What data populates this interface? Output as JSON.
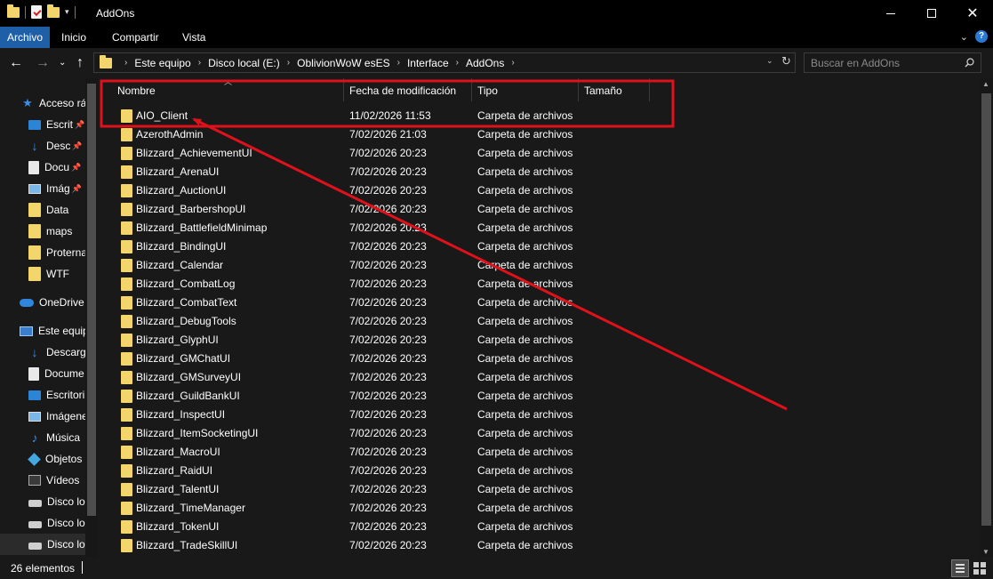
{
  "window": {
    "title": "AddOns"
  },
  "ribbon": {
    "tabs": [
      "Archivo",
      "Inicio",
      "Compartir",
      "Vista"
    ]
  },
  "address": {
    "segments": [
      "Este equipo",
      "Disco local (E:)",
      "OblivionWoW esES",
      "Interface",
      "AddOns"
    ]
  },
  "search": {
    "placeholder": "Buscar en AddOns"
  },
  "nav": {
    "items": [
      {
        "label": "Acceso rá",
        "icon": "star-icon"
      },
      {
        "label": "Escrit",
        "icon": "desktop-folder-icon",
        "pinned": true
      },
      {
        "label": "Desc",
        "icon": "download-icon",
        "pinned": true
      },
      {
        "label": "Docu",
        "icon": "document-icon",
        "pinned": true
      },
      {
        "label": "Imág",
        "icon": "pictures-icon",
        "pinned": true
      },
      {
        "label": "Data",
        "icon": "folder-icon"
      },
      {
        "label": "maps",
        "icon": "folder-icon"
      },
      {
        "label": "Proterna",
        "icon": "folder-icon"
      },
      {
        "label": "WTF",
        "icon": "folder-icon"
      },
      {
        "label": "OneDrive",
        "icon": "cloud-icon"
      },
      {
        "label": "Este equip",
        "icon": "computer-icon"
      },
      {
        "label": "Descarg",
        "icon": "download-icon"
      },
      {
        "label": "Docume",
        "icon": "document-icon"
      },
      {
        "label": "Escritori",
        "icon": "desktop-folder-icon"
      },
      {
        "label": "Imágene",
        "icon": "pictures-icon"
      },
      {
        "label": "Música",
        "icon": "music-icon"
      },
      {
        "label": "Objetos",
        "icon": "3d-objects-icon"
      },
      {
        "label": "Vídeos",
        "icon": "videos-icon"
      },
      {
        "label": "Disco lo",
        "icon": "drive-icon"
      },
      {
        "label": "Disco lo",
        "icon": "drive-icon"
      },
      {
        "label": "Disco lo",
        "icon": "drive-icon",
        "selected": true
      }
    ]
  },
  "columns": {
    "name": "Nombre",
    "date": "Fecha de modificación",
    "type": "Tipo",
    "size": "Tamaño"
  },
  "files": [
    {
      "name": "AIO_Client",
      "date": "11/02/2026 11:53",
      "type": "Carpeta de archivos"
    },
    {
      "name": "AzerothAdmin",
      "date": "7/02/2026 21:03",
      "type": "Carpeta de archivos"
    },
    {
      "name": "Blizzard_AchievementUI",
      "date": "7/02/2026 20:23",
      "type": "Carpeta de archivos"
    },
    {
      "name": "Blizzard_ArenaUI",
      "date": "7/02/2026 20:23",
      "type": "Carpeta de archivos"
    },
    {
      "name": "Blizzard_AuctionUI",
      "date": "7/02/2026 20:23",
      "type": "Carpeta de archivos"
    },
    {
      "name": "Blizzard_BarbershopUI",
      "date": "7/02/2026 20:23",
      "type": "Carpeta de archivos"
    },
    {
      "name": "Blizzard_BattlefieldMinimap",
      "date": "7/02/2026 20:23",
      "type": "Carpeta de archivos"
    },
    {
      "name": "Blizzard_BindingUI",
      "date": "7/02/2026 20:23",
      "type": "Carpeta de archivos"
    },
    {
      "name": "Blizzard_Calendar",
      "date": "7/02/2026 20:23",
      "type": "Carpeta de archivos"
    },
    {
      "name": "Blizzard_CombatLog",
      "date": "7/02/2026 20:23",
      "type": "Carpeta de archivos"
    },
    {
      "name": "Blizzard_CombatText",
      "date": "7/02/2026 20:23",
      "type": "Carpeta de archivos"
    },
    {
      "name": "Blizzard_DebugTools",
      "date": "7/02/2026 20:23",
      "type": "Carpeta de archivos"
    },
    {
      "name": "Blizzard_GlyphUI",
      "date": "7/02/2026 20:23",
      "type": "Carpeta de archivos"
    },
    {
      "name": "Blizzard_GMChatUI",
      "date": "7/02/2026 20:23",
      "type": "Carpeta de archivos"
    },
    {
      "name": "Blizzard_GMSurveyUI",
      "date": "7/02/2026 20:23",
      "type": "Carpeta de archivos"
    },
    {
      "name": "Blizzard_GuildBankUI",
      "date": "7/02/2026 20:23",
      "type": "Carpeta de archivos"
    },
    {
      "name": "Blizzard_InspectUI",
      "date": "7/02/2026 20:23",
      "type": "Carpeta de archivos"
    },
    {
      "name": "Blizzard_ItemSocketingUI",
      "date": "7/02/2026 20:23",
      "type": "Carpeta de archivos"
    },
    {
      "name": "Blizzard_MacroUI",
      "date": "7/02/2026 20:23",
      "type": "Carpeta de archivos"
    },
    {
      "name": "Blizzard_RaidUI",
      "date": "7/02/2026 20:23",
      "type": "Carpeta de archivos"
    },
    {
      "name": "Blizzard_TalentUI",
      "date": "7/02/2026 20:23",
      "type": "Carpeta de archivos"
    },
    {
      "name": "Blizzard_TimeManager",
      "date": "7/02/2026 20:23",
      "type": "Carpeta de archivos"
    },
    {
      "name": "Blizzard_TokenUI",
      "date": "7/02/2026 20:23",
      "type": "Carpeta de archivos"
    },
    {
      "name": "Blizzard_TradeSkillUI",
      "date": "7/02/2026 20:23",
      "type": "Carpeta de archivos"
    }
  ],
  "status": {
    "count": "26 elementos"
  },
  "colors": {
    "accent": "#1f5fa8",
    "annotation": "#e0111b",
    "folder": "#f3d56b",
    "background": "#191919"
  }
}
